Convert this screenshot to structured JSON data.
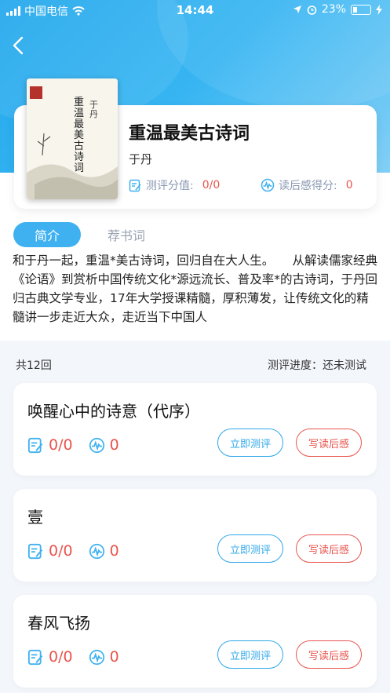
{
  "status_bar": {
    "carrier": "中国电信",
    "time": "14:44",
    "battery": "23%"
  },
  "book": {
    "title": "重温最美古诗词",
    "author": "于丹",
    "score_label": "测评分值:",
    "score_value": "0/0",
    "feel_label": "读后感得分:",
    "feel_value": "0",
    "cover_title": "重温最美古诗词",
    "cover_author": "于丹"
  },
  "tabs": {
    "intro": "简介",
    "recommend": "荐书词"
  },
  "intro_text": "和于丹一起，重温*美古诗词，回归自在大人生。　　从解读儒家经典《论语》到赏析中国传统文化*源远流长、普及率*的古诗词，于丹回归古典文学专业，17年大学授课精髓，厚积薄发，让传统文化的精髓讲一步走近大众，走近当下中国人",
  "list_meta": {
    "count": "共12回",
    "progress": "测评进度：还未测试"
  },
  "chapters": [
    {
      "title": "唤醒心中的诗意（代序）",
      "score": "0/0",
      "feel": "0",
      "test_label": "立即测评",
      "write_label": "写读后感"
    },
    {
      "title": "壹",
      "score": "0/0",
      "feel": "0",
      "test_label": "立即测评",
      "write_label": "写读后感"
    },
    {
      "title": "春风飞扬",
      "score": "0/0",
      "feel": "0",
      "test_label": "立即测评",
      "write_label": "写读后感"
    }
  ],
  "colors": {
    "accent": "#3fb1f0",
    "danger": "#e9544d",
    "muted": "#8a99b3"
  },
  "icons": {
    "back": "chevron-left-icon",
    "score": "edit-note-icon",
    "feel": "wave-badge-icon"
  }
}
